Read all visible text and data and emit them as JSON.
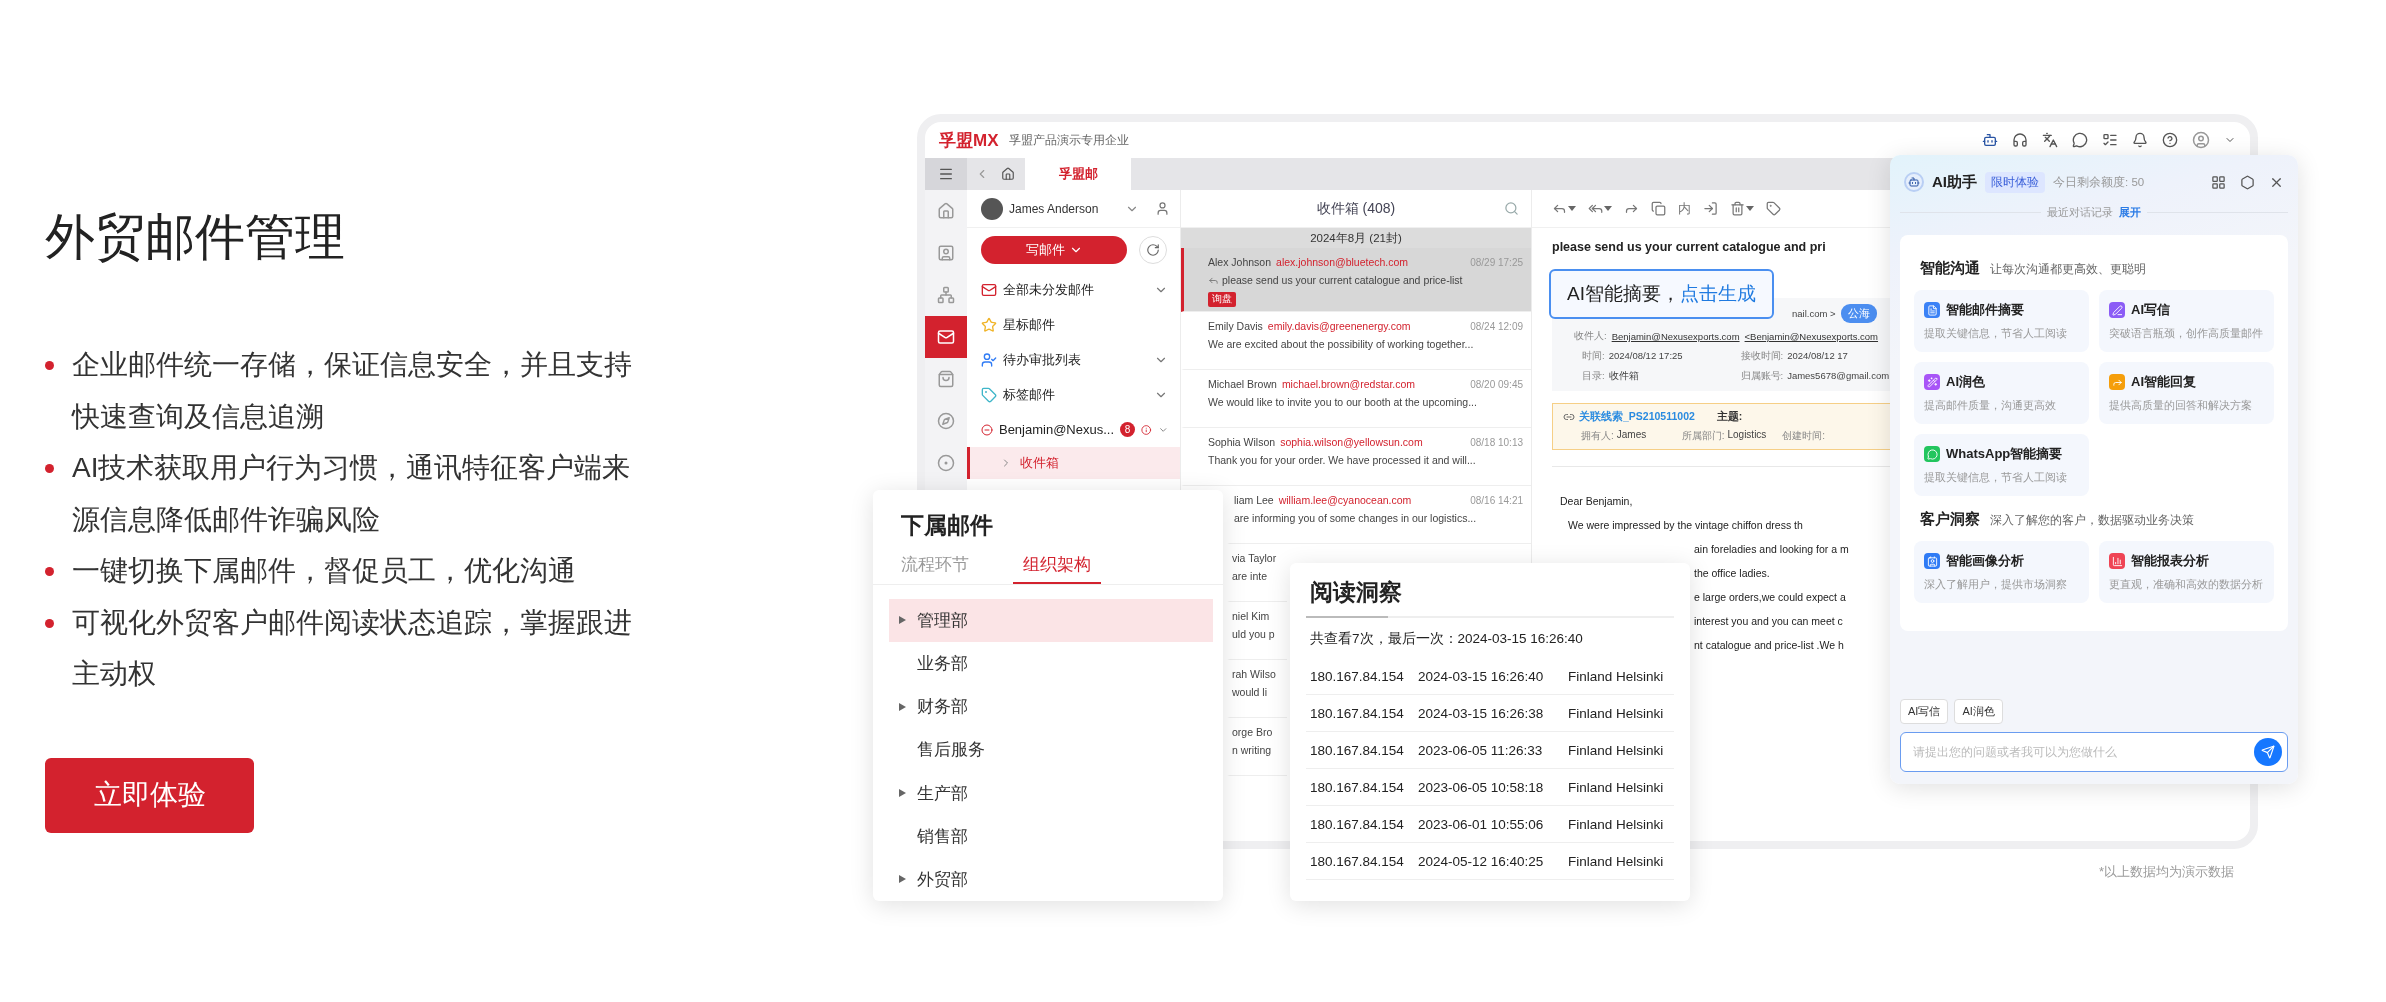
{
  "hero": {
    "title": "外贸邮件管理",
    "bullets": [
      "企业邮件统一存储，保证信息安全，并且支持快速查询及信息追溯",
      "AI技术获取用户行为习惯，通讯特征客户端来源信息降低邮件诈骗风险",
      "一键切换下属邮件，督促员工，优化沟通",
      "可视化外贸客户邮件阅读状态追踪，掌握跟进主动权"
    ],
    "cta": "立即体验"
  },
  "app": {
    "logo": "孚盟MX",
    "company": "孚盟产品演示专用企业",
    "tabs": [
      {
        "label": "孚盟邮",
        "selected": true
      }
    ],
    "rail": [
      {
        "kind": "home",
        "selected": false
      },
      {
        "kind": "contact",
        "selected": false
      },
      {
        "kind": "tree",
        "selected": false
      },
      {
        "kind": "mail",
        "selected": true
      },
      {
        "kind": "bag",
        "selected": false
      },
      {
        "kind": "compass",
        "selected": false
      },
      {
        "kind": "circle",
        "selected": false
      }
    ],
    "account": "James Anderson",
    "compose": "写邮件",
    "folders": [
      {
        "kind": "mail",
        "label": "全部未分发邮件",
        "expandable": true
      },
      {
        "kind": "star",
        "label": "星标邮件",
        "expandable": false
      },
      {
        "kind": "approval",
        "label": "待办审批列表",
        "expandable": true
      },
      {
        "kind": "tag",
        "label": "标签邮件",
        "expandable": true
      },
      {
        "kind": "account",
        "label": "Benjamin@Nexus...",
        "expandable": true,
        "badge": "8"
      }
    ],
    "subfolders": [
      {
        "label": "收件箱",
        "selected": true
      }
    ],
    "mail_list": {
      "title": "收件箱 (408)",
      "group": "2024年8月 (21封)",
      "rows": [
        {
          "kind": "full",
          "sender": "Alex Johnson",
          "email": "alex.johnson@bluetech.com",
          "time": "08/29 17:25",
          "preview": "please send us your current catalogue and price-list",
          "tag": "询盘",
          "replied": true,
          "selected": true
        },
        {
          "kind": "full",
          "sender": "Emily Davis",
          "email": "emily.davis@greenenergy.com",
          "time": "08/24 12:09",
          "preview": "We are excited about the possibility of working together...",
          "replied": false,
          "selected": false
        },
        {
          "kind": "full",
          "sender": "Michael Brown",
          "email": "michael.brown@redstar.com",
          "time": "08/20 09:45",
          "preview": "We would like to invite you to our booth at the upcoming...",
          "replied": false,
          "selected": false
        },
        {
          "kind": "full",
          "sender": "Sophia Wilson",
          "email": "sophia.wilson@yellowsun.com",
          "time": "08/18 10:13",
          "preview": "Thank you for your order. We have processed it and will...",
          "replied": false,
          "selected": false
        },
        {
          "kind": "covered",
          "sender": "liam Lee",
          "email": "william.lee@cyanocean.com",
          "time": "08/16 14:21",
          "preview": "are informing you of some changes in our logistics...",
          "replied": false,
          "selected": false
        },
        {
          "kind": "boxed",
          "sender": "via Taylor",
          "preview": "are inte",
          "replied": false,
          "selected": false
        },
        {
          "kind": "boxed",
          "sender": "niel Kim",
          "preview": "uld you p",
          "replied": false,
          "selected": false
        },
        {
          "kind": "boxed",
          "sender": "rah Wilso",
          "preview": "would li",
          "replied": false,
          "selected": false
        },
        {
          "kind": "boxed",
          "sender": "orge Bro",
          "preview": "n writing",
          "replied": false,
          "selected": false
        }
      ]
    },
    "reader": {
      "toolbar": [
        {
          "kind": "reply",
          "menu": true
        },
        {
          "kind": "reply-all",
          "menu": true
        },
        {
          "kind": "forward",
          "menu": false
        },
        {
          "kind": "copy",
          "menu": false
        },
        {
          "kind": "text",
          "label": "内",
          "menu": false
        },
        {
          "kind": "move",
          "menu": false
        },
        {
          "kind": "delete",
          "menu": true
        },
        {
          "kind": "tag",
          "menu": false
        }
      ],
      "subject": "please send us your current catalogue and pri",
      "sender_tail": "nail.com >",
      "sender_badge": "公海",
      "recipient": {
        "label": "收件人:",
        "value": "Benjamin@Nexusexports.com",
        "value2": "<Benjamin@Nexusexports.com"
      },
      "meta_rows": [
        [
          {
            "label": "时间:",
            "value": "2024/08/12 17:25"
          },
          {
            "label": "接收时间:",
            "value": "2024/08/12 17"
          }
        ],
        [
          {
            "label": "目录:",
            "value": "收件箱"
          },
          {
            "label": "归属账号:",
            "value": "James5678@gmail.com"
          }
        ]
      ],
      "lead": {
        "title": "关联线索_PS210511002",
        "subject_label": "主题:",
        "fields": [
          {
            "label": "拥有人:",
            "value": "James"
          },
          {
            "label": "所属部门:",
            "value": "Logistics"
          },
          {
            "label": "创建时间:"
          }
        ]
      },
      "body": [
        {
          "kind": "greeting",
          "text": "Dear Benjamin,"
        },
        {
          "kind": "full",
          "text": "We were impressed by the vintage chiffon dress th"
        },
        {
          "kind": "covered",
          "text": "ain foreladies and looking for a m"
        },
        {
          "kind": "covered",
          "text": "the office ladies."
        },
        {
          "kind": "covered",
          "text": "e large orders,we could expect a"
        },
        {
          "kind": "covered",
          "text": "interest you and you can meet c"
        },
        {
          "kind": "covered",
          "text": "nt catalogue and price-list .We h"
        }
      ]
    }
  },
  "summary_callout": {
    "text": "AI智能摘要，",
    "link": "点击生成"
  },
  "subordinates": {
    "title": "下属邮件",
    "tabs": [
      {
        "label": "流程环节",
        "selected": false
      },
      {
        "label": "组织架构",
        "selected": true
      }
    ],
    "departments": [
      {
        "label": "管理部",
        "kind": "group",
        "selected": true
      },
      {
        "label": "业务部",
        "kind": "leaf",
        "selected": false
      },
      {
        "label": "财务部",
        "kind": "group",
        "selected": false
      },
      {
        "label": "售后服务",
        "kind": "leaf",
        "selected": false
      },
      {
        "label": "生产部",
        "kind": "group",
        "selected": false
      },
      {
        "label": "销售部",
        "kind": "leaf",
        "selected": false
      },
      {
        "label": "外贸部",
        "kind": "group",
        "selected": false
      }
    ]
  },
  "read_insight": {
    "title": "阅读洞察",
    "summary": "共查看7次，最后一次：2024-03-15 16:26:40",
    "rows": [
      [
        "180.167.84.154",
        "2024-03-15 16:26:40",
        "Finland Helsinki"
      ],
      [
        "180.167.84.154",
        "2024-03-15 16:26:38",
        "Finland Helsinki"
      ],
      [
        "180.167.84.154",
        "2023-06-05 11:26:33",
        "Finland Helsinki"
      ],
      [
        "180.167.84.154",
        "2023-06-05 10:58:18",
        "Finland Helsinki"
      ],
      [
        "180.167.84.154",
        "2023-06-01 10:55:06",
        "Finland Helsinki"
      ],
      [
        "180.167.84.154",
        "2024-05-12 16:40:25",
        "Finland Helsinki"
      ]
    ]
  },
  "ai": {
    "title": "AI助手",
    "badge": "限时体验",
    "quota": "今日剩余额度: 50",
    "history": "最近对话记录",
    "expand": "展开",
    "sections": [
      {
        "title": "智能沟通",
        "subtitle": "让每次沟通都更高效、更聪明",
        "tiles": [
          {
            "kind": "summary",
            "title": "智能邮件摘要",
            "desc": "提取关键信息，节省人工阅读",
            "color": "#3b82f6"
          },
          {
            "kind": "write",
            "title": "AI写信",
            "desc": "突破语言瓶颈，创作高质量邮件",
            "color": "#8b5cf6"
          },
          {
            "kind": "polish",
            "title": "AI润色",
            "desc": "提高邮件质量，沟通更高效",
            "color": "#a855f7"
          },
          {
            "kind": "reply",
            "title": "AI智能回复",
            "desc": "提供高质量的回答和解决方案",
            "color": "#f59e0b"
          },
          {
            "kind": "whatsapp",
            "title": "WhatsApp智能摘要",
            "desc": "提取关键信息，节省人工阅读",
            "color": "#22c55e"
          }
        ]
      },
      {
        "title": "客户洞察",
        "subtitle": "深入了解您的客户，数据驱动业务决策",
        "tiles": [
          {
            "kind": "profile",
            "title": "智能画像分析",
            "desc": "深入了解用户，提供市场洞察",
            "color": "#2f7bf5"
          },
          {
            "kind": "report",
            "title": "智能报表分析",
            "desc": "更直观，准确和高效的数据分析",
            "color": "#ef4455"
          }
        ]
      }
    ],
    "chips": [
      "AI写信",
      "AI润色"
    ],
    "placeholder": "请提出您的问题或者我可以为您做什么"
  },
  "footnote": "*以上数据均为演示数据"
}
